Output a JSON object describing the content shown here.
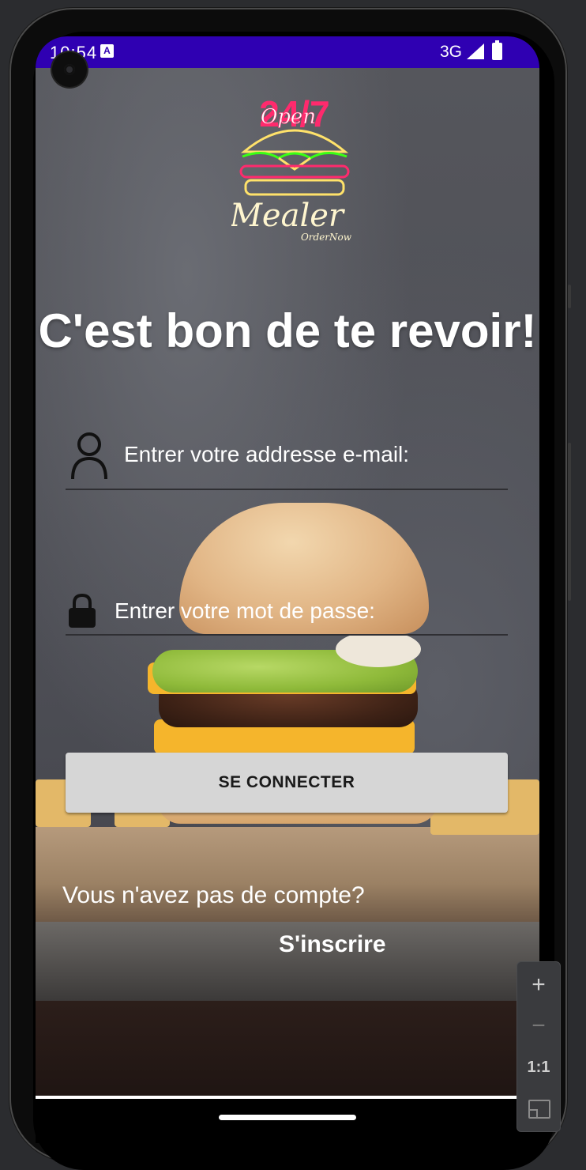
{
  "status_bar": {
    "time": "10:54",
    "notification_icon": "A",
    "network": "3G"
  },
  "logo": {
    "badge_text": "24/7",
    "open_text": "Open",
    "brand_name": "Mealer",
    "tagline": "OrderNow"
  },
  "login": {
    "title": "C'est bon de te revoir!",
    "email_placeholder": "Entrer votre addresse e-mail:",
    "password_placeholder": "Entrer votre mot de passe:",
    "submit_label": "SE CONNECTER",
    "no_account_text": "Vous n'avez pas de compte?",
    "signup_label": "S'inscrire"
  },
  "emulator_controls": {
    "zoom_in": "+",
    "zoom_out": "−",
    "actual_size": "1:1"
  },
  "colors": {
    "status_bar": "#2f00b2",
    "button_bg": "#d6d6d6",
    "neon_pink": "#ff2a6d",
    "neon_yellow": "#ffe26a",
    "neon_green": "#39ff14"
  }
}
